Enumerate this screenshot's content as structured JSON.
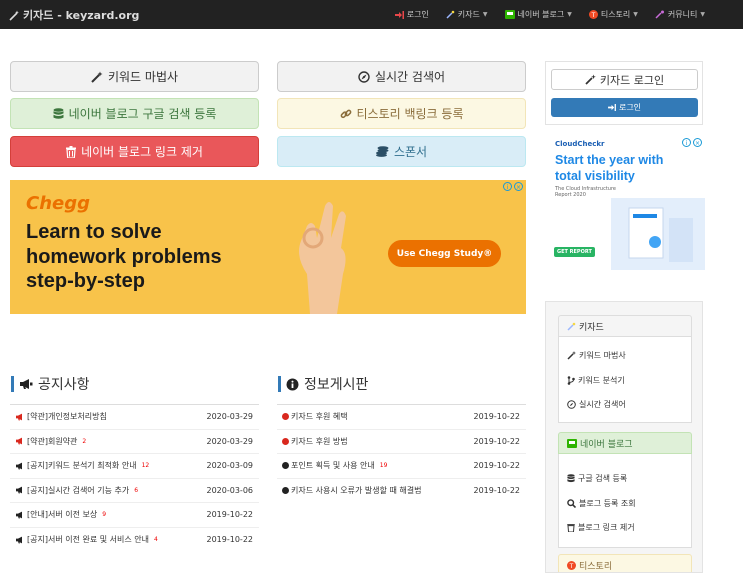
{
  "app": {
    "title": "키자드 - keyzard.org"
  },
  "nav": [
    {
      "label": "로그인",
      "icon": "sign-in-icon",
      "caret": false
    },
    {
      "label": "키자드",
      "icon": "magic-wand-icon",
      "caret": true
    },
    {
      "label": "네이버 블로그",
      "icon": "naver-blog-icon",
      "caret": true
    },
    {
      "label": "티스토리",
      "icon": "tistory-icon",
      "caret": true
    },
    {
      "label": "커뮤니티",
      "icon": "community-icon",
      "caret": true
    }
  ],
  "buttons": {
    "keyword_wizard": "키워드 마법사",
    "realtime_search": "실시간 검색어",
    "naver_register": "네이버 블로그 구글 검색 등록",
    "tistory_backlink": "티스토리 백링크 등록",
    "naver_link_remove": "네이버 블로그 링크 제거",
    "sponsor": "스폰서"
  },
  "ads": {
    "chegg": {
      "brand": "Chegg",
      "headline": "Learn to solve\nhomework problems\nstep-by-step",
      "cta": "Use Chegg Study®"
    },
    "cloudcheckr": {
      "brand": "CloudCheckr",
      "headline": "Start the year with\ntotal visibility",
      "sub": "The Cloud Infrastructure\nReport 2020",
      "cta": "GET REPORT"
    }
  },
  "login": {
    "title": "키자드 로그인",
    "button": "로그인"
  },
  "sidebar": {
    "keyzard": {
      "header": "키자드",
      "items": [
        "키워드 마법사",
        "키워드 분석기",
        "실시간 검색어"
      ]
    },
    "naver": {
      "header": "네이버 블로그",
      "items": [
        "구글 검색 등록",
        "블로그 등록 조회",
        "블로그 링크 제거"
      ]
    },
    "tistory": {
      "header": "티스토리"
    }
  },
  "notices": {
    "title": "공지사항",
    "rows": [
      {
        "title": "[약관]개인정보처리방침",
        "count": "",
        "date": "2020-03-29"
      },
      {
        "title": "[약관]회원약관",
        "count": "2",
        "date": "2020-03-29"
      },
      {
        "title": "[공지]키워드 분석기 최적화 안내",
        "count": "12",
        "date": "2020-03-09"
      },
      {
        "title": "[공지]실시간 검색어 기능 추가",
        "count": "6",
        "date": "2020-03-06"
      },
      {
        "title": "[안내]서버 이전 보상",
        "count": "9",
        "date": "2019-10-22"
      },
      {
        "title": "[공지]서버 이전 완료 및 서비스 안내",
        "count": "4",
        "date": "2019-10-22"
      }
    ]
  },
  "info": {
    "title": "정보게시판",
    "rows": [
      {
        "title": "키자드 후원 혜택",
        "count": "",
        "date": "2019-10-22",
        "bullet": "red"
      },
      {
        "title": "키자드 후원 방법",
        "count": "",
        "date": "2019-10-22",
        "bullet": "red"
      },
      {
        "title": "포인트 획득 및 사용 안내",
        "count": "19",
        "date": "2019-10-22",
        "bullet": "dark"
      },
      {
        "title": "키자드 사용시 오류가 발생할 때 해결법",
        "count": "",
        "date": "2019-10-22",
        "bullet": "dark"
      }
    ]
  },
  "colors": {
    "navbar": "#222222",
    "primary": "#337ab7",
    "danger": "#e9575a",
    "chegg_bg": "#f8c34a",
    "chegg_orange": "#eb7100"
  }
}
